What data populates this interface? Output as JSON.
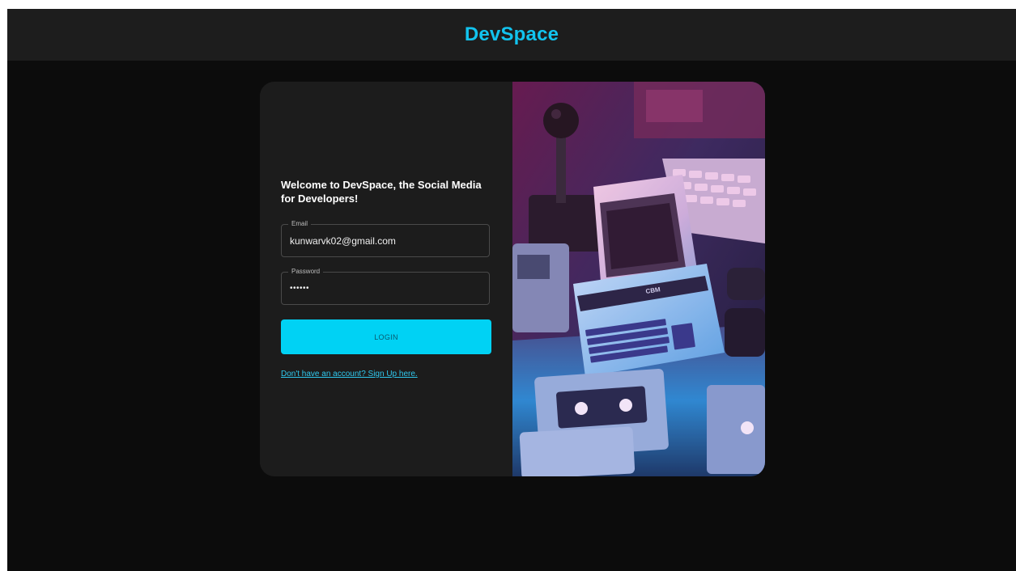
{
  "app": {
    "brand": "DevSpace"
  },
  "login": {
    "welcome": "Welcome to DevSpace, the Social Media for Developers!",
    "email_label": "Email",
    "email_value": "kunwarvk02@gmail.com",
    "password_label": "Password",
    "password_value": "••••••",
    "login_button": "LOGIN",
    "signup_link": "Don't have an account? Sign Up here."
  },
  "hero_image": {
    "label": "CBM"
  },
  "colors": {
    "accent": "#00d2f4",
    "brand": "#12c3ee",
    "background": "#0c0c0c",
    "card": "#1c1c1c",
    "navbar": "#1d1d1d"
  }
}
